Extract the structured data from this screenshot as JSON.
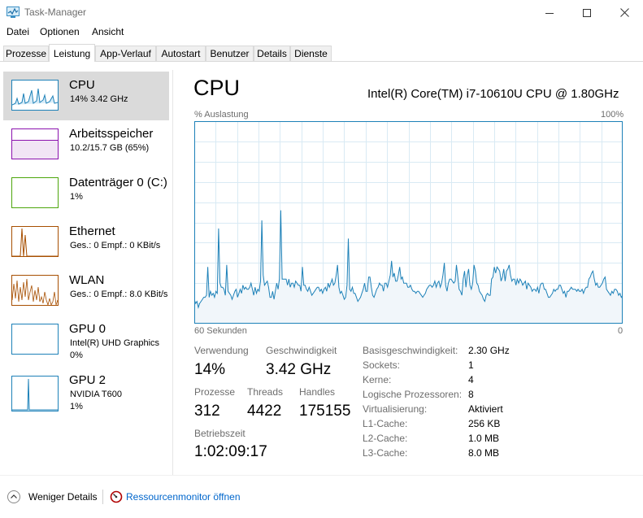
{
  "window": {
    "title": "Task-Manager"
  },
  "menu": [
    "Datei",
    "Optionen",
    "Ansicht"
  ],
  "tabs": [
    "Prozesse",
    "Leistung",
    "App-Verlauf",
    "Autostart",
    "Benutzer",
    "Details",
    "Dienste"
  ],
  "active_tab": "Leistung",
  "sidebar": {
    "items": [
      {
        "name": "CPU",
        "line1": "14% 3.42 GHz",
        "line2": "",
        "color": "#1d81b8"
      },
      {
        "name": "Arbeitsspeicher",
        "line1": "10.2/15.7 GB (65%)",
        "line2": "",
        "color": "#8b12ae"
      },
      {
        "name": "Datenträger 0 (C:)",
        "line1": "1%",
        "line2": "",
        "color": "#4da60c"
      },
      {
        "name": "Ethernet",
        "line1": "Ges.: 0 Empf.: 0 KBit/s",
        "line2": "",
        "color": "#a74f01"
      },
      {
        "name": "WLAN",
        "line1": "Ges.: 0 Empf.: 8.0 KBit/s",
        "line2": "",
        "color": "#a74f01"
      },
      {
        "name": "GPU 0",
        "line1": "Intel(R) UHD Graphics",
        "line2": "0%",
        "color": "#1d81b8"
      },
      {
        "name": "GPU 2",
        "line1": "NVIDIA T600",
        "line2": "1%",
        "color": "#1d81b8"
      }
    ]
  },
  "main": {
    "title": "CPU",
    "model": "Intel(R) Core(TM) i7-10610U CPU @ 1.80GHz",
    "util_label": "% Auslastung",
    "max_label": "100%",
    "time_label": "60 Sekunden",
    "zero_label": "0",
    "graph_color": "#1d81b8",
    "graph_fill": "#f1f6fa",
    "graph_grid": "#d9eaf4",
    "cpu_history": [
      12,
      10,
      11,
      8,
      10,
      11,
      12,
      13,
      13,
      14,
      28,
      13,
      16,
      14,
      15,
      13,
      16,
      15,
      47,
      20,
      18,
      18,
      17,
      14,
      29,
      16,
      15,
      14,
      12,
      14,
      16,
      17,
      13,
      15,
      17,
      15,
      19,
      17,
      18,
      17,
      17,
      18,
      20,
      17,
      14,
      18,
      15,
      17,
      16,
      21,
      51,
      24,
      19,
      20,
      21,
      18,
      13,
      13,
      16,
      12,
      16,
      20,
      17,
      22,
      56,
      22,
      22,
      22,
      22,
      19,
      22,
      18,
      20,
      20,
      18,
      21,
      20,
      19,
      19,
      16,
      28,
      19,
      19,
      17,
      16,
      18,
      16,
      14,
      15,
      16,
      17,
      18,
      18,
      16,
      17,
      15,
      17,
      18,
      16,
      20,
      18,
      20,
      22,
      19,
      20,
      24,
      29,
      18,
      15,
      16,
      14,
      12,
      13,
      19,
      42,
      17,
      16,
      18,
      15,
      15,
      13,
      11,
      12,
      13,
      15,
      17,
      20,
      16,
      16,
      23,
      23,
      18,
      14,
      13,
      15,
      17,
      18,
      20,
      19,
      19,
      16,
      20,
      20,
      18,
      21,
      24,
      31,
      23,
      25,
      21,
      21,
      24,
      28,
      22,
      23,
      20,
      20,
      20,
      18,
      18,
      19,
      17,
      16,
      16,
      15,
      16,
      16,
      15,
      14,
      13,
      14,
      15,
      17,
      18,
      19,
      19,
      18,
      19,
      21,
      18,
      20,
      21,
      18,
      20,
      24,
      30,
      19,
      16,
      20,
      22,
      22,
      21,
      20,
      21,
      29,
      23,
      17,
      16,
      14,
      22,
      26,
      18,
      24,
      27,
      19,
      17,
      20,
      29,
      26,
      20,
      19,
      16,
      15,
      14,
      12,
      11,
      14,
      15,
      14,
      14,
      22,
      23,
      28,
      25,
      28,
      27,
      26,
      21,
      23,
      27,
      21,
      26,
      27,
      29,
      24,
      21,
      22,
      22,
      19,
      22,
      20,
      22,
      21,
      19,
      20,
      21,
      17,
      20,
      19,
      18,
      16,
      17,
      17,
      16,
      18,
      15,
      19,
      20,
      20,
      17,
      17,
      15,
      13,
      13,
      14,
      15,
      17,
      16,
      17,
      17,
      19,
      19,
      17,
      15,
      16,
      13,
      16,
      16,
      17,
      18,
      17,
      17,
      17,
      16,
      17,
      16,
      16,
      17,
      15,
      17,
      18,
      18,
      22,
      23,
      25,
      26,
      22,
      19,
      20,
      18,
      18,
      19,
      20,
      22,
      23,
      17,
      16,
      15,
      14,
      16,
      15,
      17,
      17,
      16,
      14,
      15,
      13,
      14
    ],
    "stats": {
      "verwendung_label": "Verwendung",
      "verwendung_value": "14%",
      "geschw_label": "Geschwindigkeit",
      "geschw_value": "3.42 GHz",
      "prozesse_label": "Prozesse",
      "prozesse_value": "312",
      "threads_label": "Threads",
      "threads_value": "4422",
      "handles_label": "Handles",
      "handles_value": "175155",
      "betrieb_label": "Betriebszeit",
      "betrieb_value": "1:02:09:17"
    },
    "specs": [
      {
        "label": "Basisgeschwindigkeit:",
        "value": "2.30 GHz"
      },
      {
        "label": "Sockets:",
        "value": "1"
      },
      {
        "label": "Kerne:",
        "value": "4"
      },
      {
        "label": "Logische Prozessoren:",
        "value": "8"
      },
      {
        "label": "Virtualisierung:",
        "value": "Aktiviert"
      },
      {
        "label": "L1-Cache:",
        "value": "256 KB"
      },
      {
        "label": "L2-Cache:",
        "value": "1.0 MB"
      },
      {
        "label": "L3-Cache:",
        "value": "8.0 MB"
      }
    ]
  },
  "footer": {
    "less_details": "Weniger Details",
    "resmon": "Ressourcenmonitor öffnen"
  }
}
